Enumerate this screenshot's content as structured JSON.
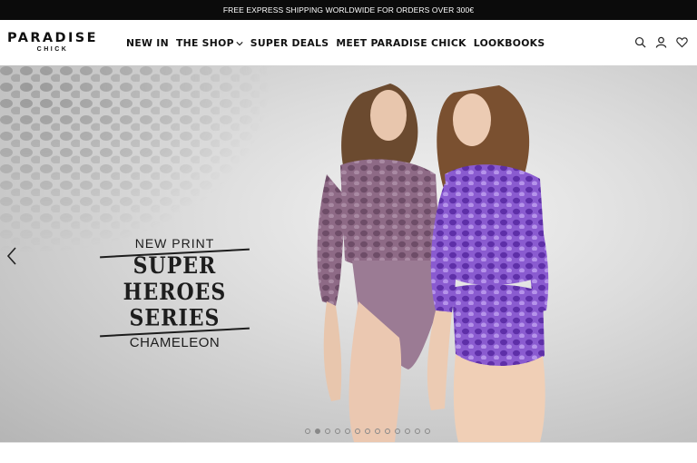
{
  "promo_bar": {
    "text": "FREE EXPRESS SHIPPING WORLDWIDE FOR ORDERS OVER 300€"
  },
  "header": {
    "logo_line1": "PARADISE",
    "logo_line2": "CHICK",
    "nav": [
      {
        "label": "NEW IN"
      },
      {
        "label": "THE SHOP"
      },
      {
        "label": "SUPER DEALS"
      },
      {
        "label": "MEET PARADISE CHICK"
      },
      {
        "label": "LOOKBOOKS"
      }
    ],
    "icons": [
      "search-icon",
      "account-icon",
      "wishlist-heart-icon"
    ]
  },
  "hero": {
    "kicker": "NEW PRINT",
    "title_line1": "SUPER HEROES",
    "title_line2": "SERIES",
    "subtitle": "CHAMELEON",
    "slide_count": 13,
    "active_slide": 2
  },
  "colors": {
    "promo_bg": "#0b0b0b",
    "accent_purple": "#8a5bd0",
    "mauve": "#8e6a86"
  }
}
